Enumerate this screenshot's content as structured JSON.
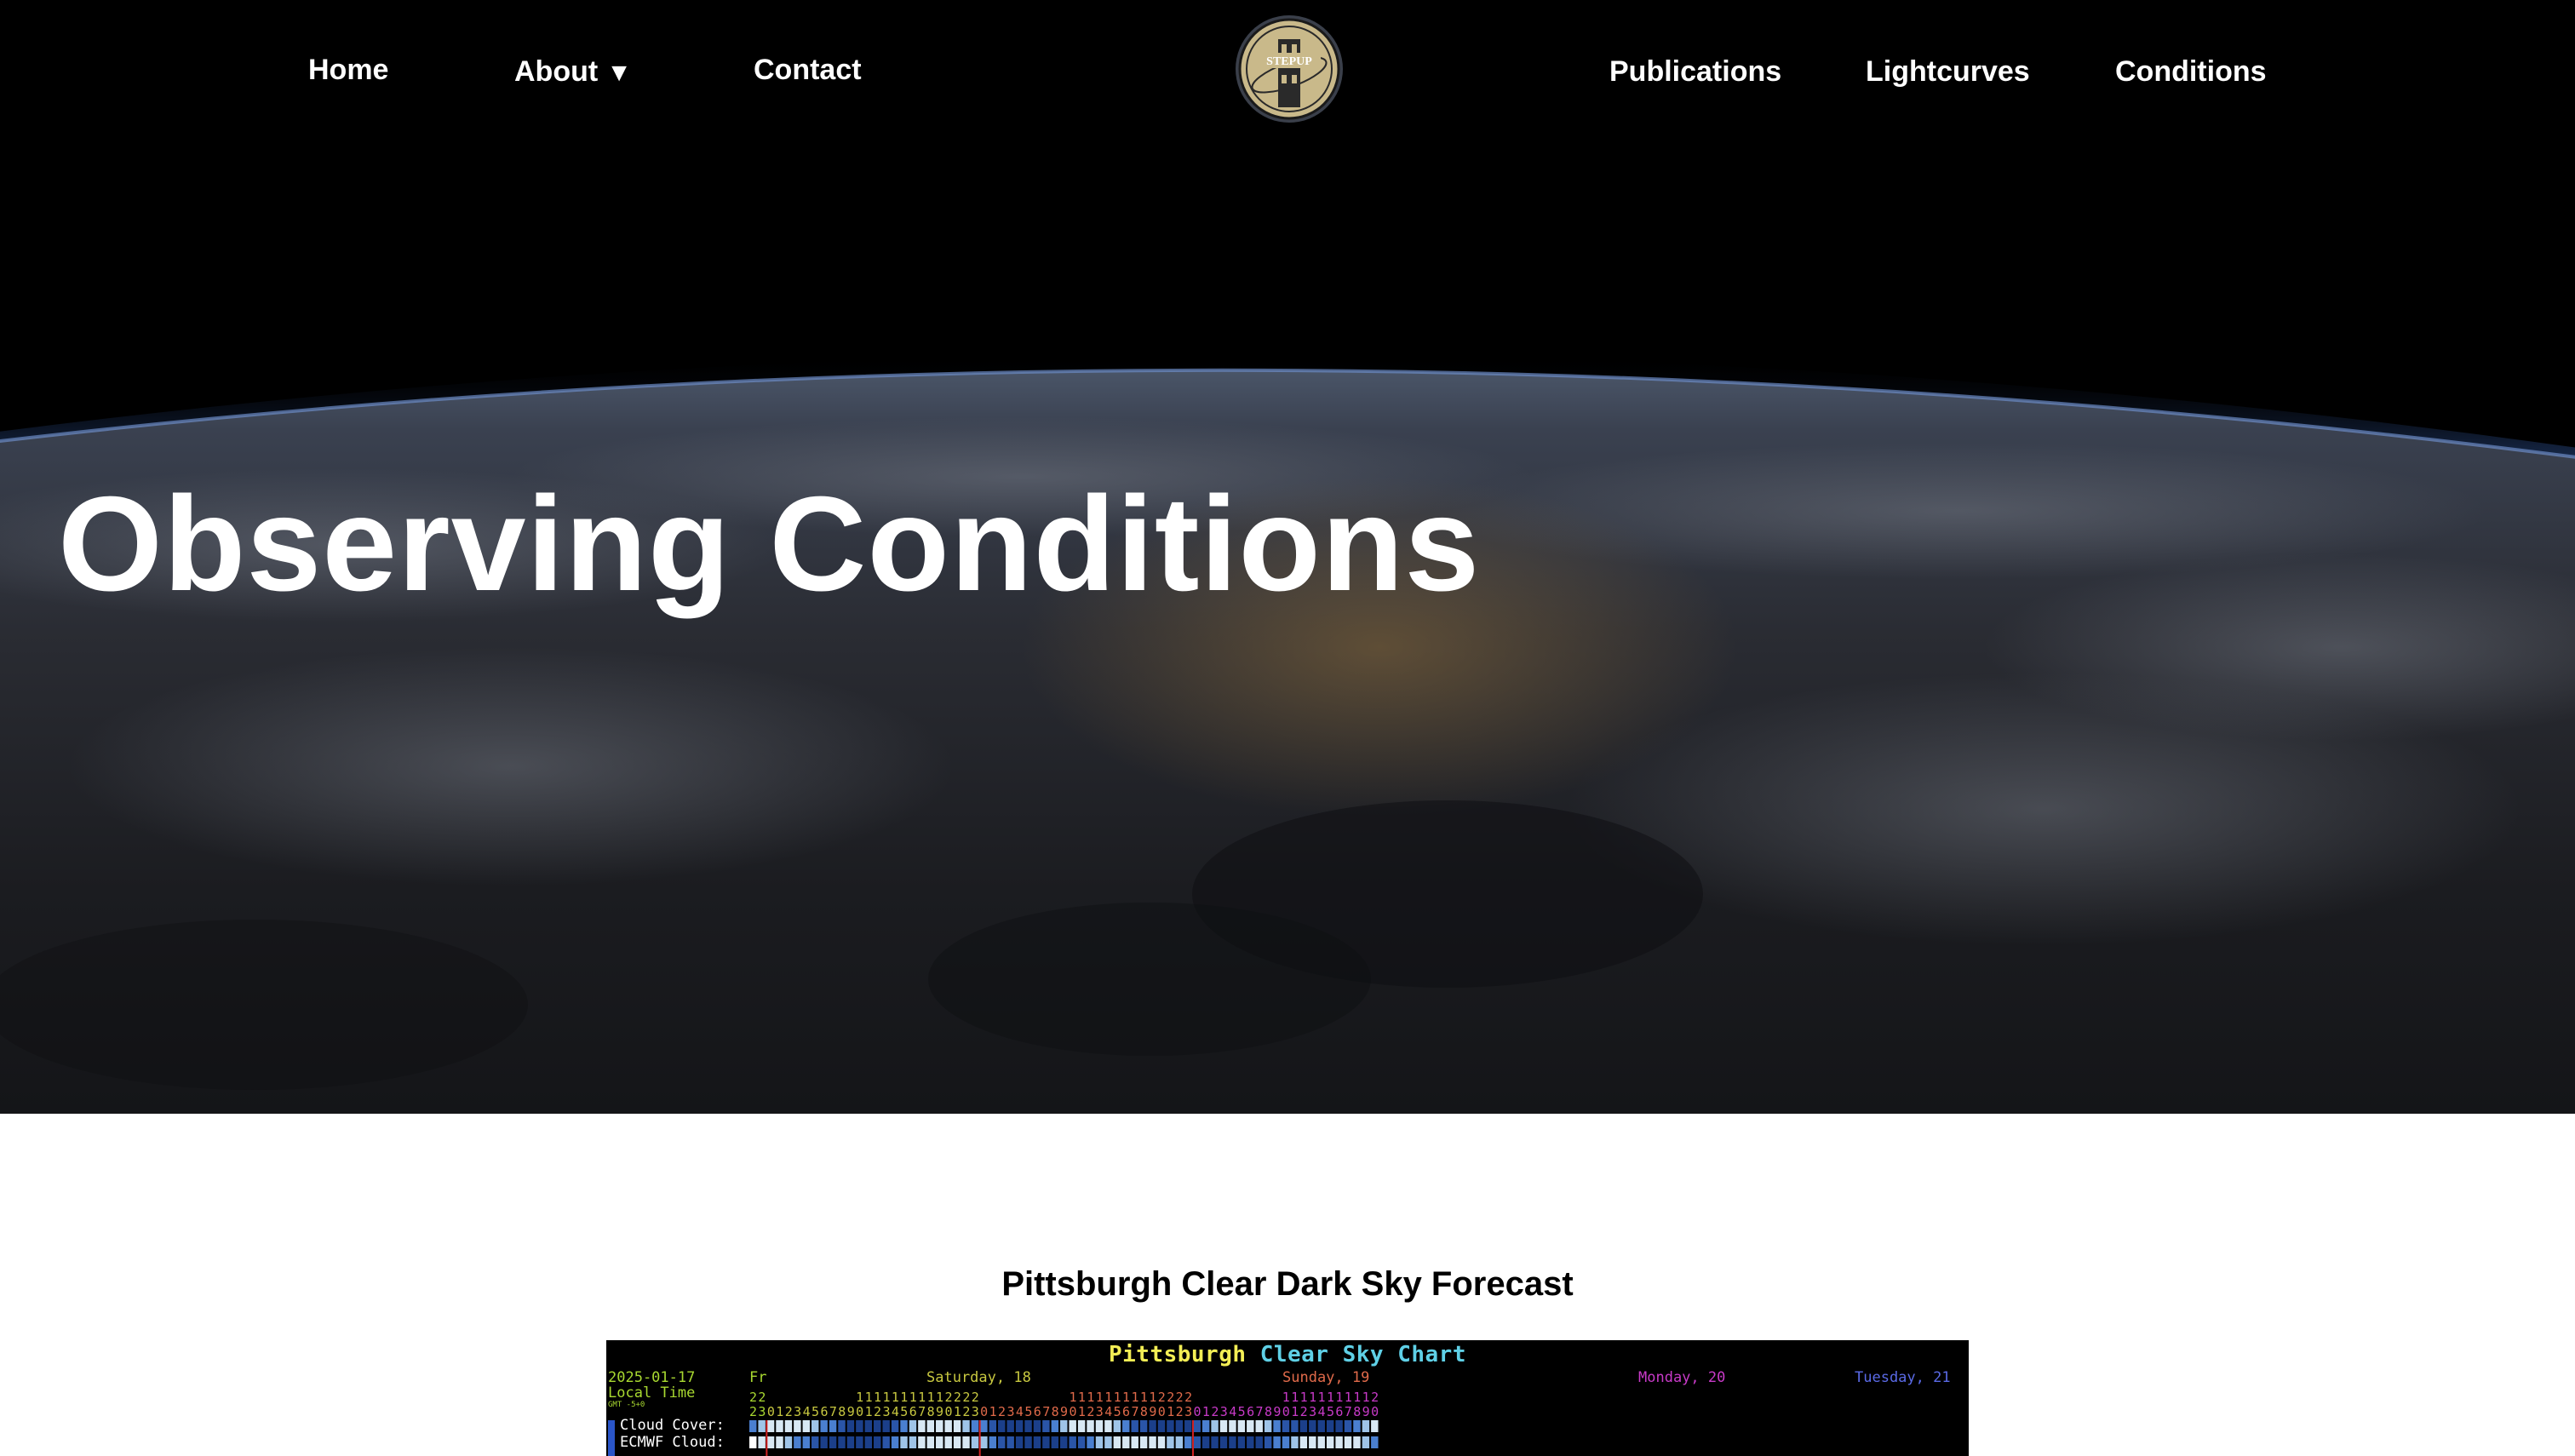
{
  "nav": {
    "home": "Home",
    "about": "About",
    "about_caret": "▼",
    "contact": "Contact",
    "publications": "Publications",
    "lightcurves": "Lightcurves",
    "conditions": "Conditions",
    "logo_text": "STEPUP"
  },
  "hero": {
    "title": "Observing Conditions"
  },
  "forecast": {
    "heading": "Pittsburgh Clear Dark Sky Forecast",
    "chart": {
      "title_part1": "Pittsburgh",
      "title_part2": "Clear Sky Chart",
      "date": "2025-01-17",
      "local_time": "Local Time",
      "gmt": "GMT -5+0",
      "day_fr": "Fr",
      "day_sat": "Saturday, 18",
      "day_sun": "Sunday, 19",
      "day_mon": "Monday, 20",
      "day_tue": "Tuesday, 21",
      "row_cloud": "Cloud Cover:",
      "row_ecmwf": "ECMWF Cloud:"
    }
  },
  "colors": {
    "hero_bg": "#000000",
    "nav_text": "#ffffff",
    "chart_title_yellow": "#f3ee55",
    "chart_title_cyan": "#5fd0e6",
    "day_fr": "#a8d830",
    "day_sat": "#c8c840",
    "day_sun": "#e06a4a",
    "day_mon": "#c83ac8",
    "day_tue": "#5a6ae6"
  }
}
